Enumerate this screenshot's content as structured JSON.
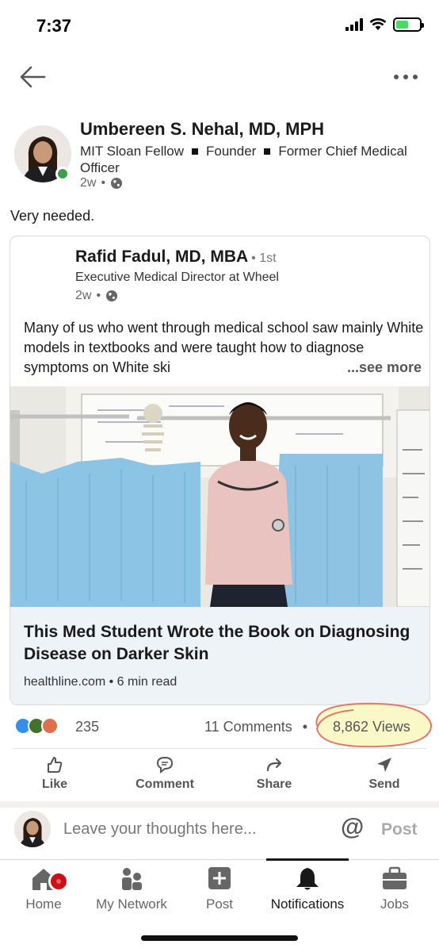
{
  "status_bar": {
    "time": "7:37"
  },
  "post": {
    "author": {
      "name": "Umbereen S. Nehal, MD, MPH",
      "headline_parts": [
        "MIT Sloan Fellow",
        "Founder",
        "Former Chief Medical Officer"
      ],
      "time_ago": "2w"
    },
    "text": "Very needed.",
    "shared": {
      "name": "Rafid Fadul, MD, MBA",
      "degree": "1st",
      "headline": "Executive Medical Director at Wheel",
      "time_ago": "2w",
      "text": "Many of us who went through medical school saw mainly White models in textbooks and were taught how to diagnose symptoms on White ski",
      "see_more": "...see more",
      "article": {
        "title": "This Med Student Wrote the Book on Diagnosing Disease on Darker Skin",
        "source": "healthline.com",
        "read_time": "6 min read"
      }
    },
    "social": {
      "reaction_count": "235",
      "comments": "11 Comments",
      "views": "8,862 Views"
    },
    "actions": {
      "like": "Like",
      "comment": "Comment",
      "share": "Share",
      "send": "Send"
    }
  },
  "composer": {
    "placeholder": "Leave your thoughts here...",
    "at": "@",
    "post": "Post"
  },
  "bottom_nav": {
    "home": "Home",
    "network": "My Network",
    "post": "Post",
    "notifications": "Notifications",
    "jobs": "Jobs"
  },
  "colors": {
    "accent": "#0a66c2",
    "online": "#3c9e4a",
    "badge": "#cc1016",
    "highlight": "#f3f07a"
  }
}
